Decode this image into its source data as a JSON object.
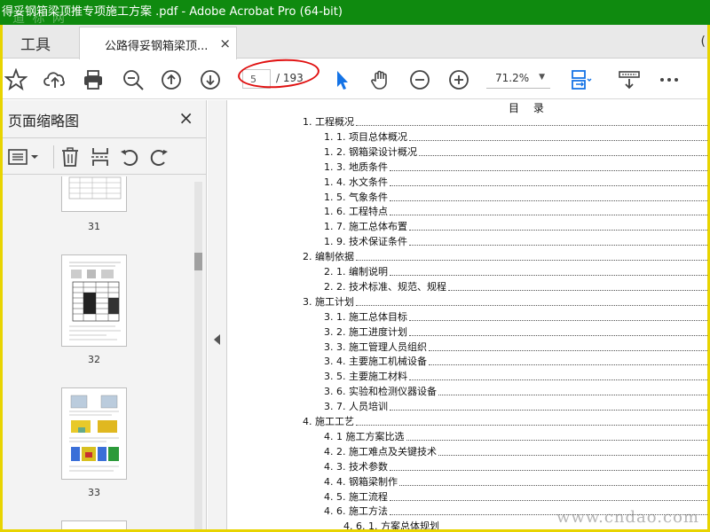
{
  "window": {
    "title": "得妥钢箱梁顶推专项施工方案 .pdf - Adobe Acrobat Pro (64-bit)",
    "watermark_top": "道 标 网"
  },
  "tabs": {
    "tools_label": "工具",
    "doc_label": "公路得妥钢箱梁顶...",
    "close_glyph": "×"
  },
  "toolbar": {
    "current_page": "5",
    "total_pages": "/ 193",
    "zoom": "71.2%",
    "icons": [
      "star-icon",
      "cloud-upload-icon",
      "print-icon",
      "zoom-out-search-icon",
      "page-up-icon",
      "page-down-icon",
      "select-arrow-icon",
      "hand-icon",
      "zoom-out-icon",
      "zoom-in-icon",
      "fit-page-icon",
      "scroll-mode-icon",
      "more-icon"
    ],
    "accent_color": "#1473e6",
    "annotation_color": "#e01010"
  },
  "sidebar": {
    "title": "页面缩略图",
    "close_glyph": "×",
    "thumbnails": [
      {
        "page": "31"
      },
      {
        "page": "32"
      },
      {
        "page": "33"
      }
    ]
  },
  "toc": {
    "heading": "目 录",
    "items": [
      {
        "text": "1. 工程概况",
        "level": 1
      },
      {
        "text": "1. 1. 项目总体概况",
        "level": 2
      },
      {
        "text": "1. 2. 钢箱梁设计概况",
        "level": 2
      },
      {
        "text": "1. 3. 地质条件",
        "level": 2
      },
      {
        "text": "1. 4. 水文条件",
        "level": 2
      },
      {
        "text": "1. 5. 气象条件",
        "level": 2
      },
      {
        "text": "1. 6. 工程特点",
        "level": 2
      },
      {
        "text": "1. 7.  施工总体布置",
        "level": 2
      },
      {
        "text": "1. 9. 技术保证条件",
        "level": 2
      },
      {
        "text": "2. 编制依据",
        "level": 1
      },
      {
        "text": "2. 1. 编制说明",
        "level": 2
      },
      {
        "text": "2. 2. 技术标准、规范、规程",
        "level": 2
      },
      {
        "text": "3. 施工计划",
        "level": 1
      },
      {
        "text": "3. 1. 施工总体目标",
        "level": 2
      },
      {
        "text": "3. 2. 施工进度计划",
        "level": 2
      },
      {
        "text": "3. 3. 施工管理人员组织",
        "level": 2
      },
      {
        "text": "3. 4. 主要施工机械设备",
        "level": 2
      },
      {
        "text": "3. 5. 主要施工材料",
        "level": 2
      },
      {
        "text": "3. 6. 实验和检测仪器设备",
        "level": 2
      },
      {
        "text": "3. 7. 人员培训",
        "level": 2
      },
      {
        "text": "4.  施工工艺",
        "level": 1
      },
      {
        "text": "4. 1 施工方案比选",
        "level": 2
      },
      {
        "text": "4. 2. 施工难点及关键技术",
        "level": 2
      },
      {
        "text": "4. 3. 技术参数",
        "level": 2
      },
      {
        "text": "4. 4. 钢箱梁制作",
        "level": 2
      },
      {
        "text": "4. 5. 施工流程",
        "level": 2
      },
      {
        "text": "4. 6. 施工方法",
        "level": 2
      },
      {
        "text": "4. 6. 1. 方案总体规划",
        "level": 3
      }
    ]
  },
  "watermark_bottom": "www.cndao.com"
}
